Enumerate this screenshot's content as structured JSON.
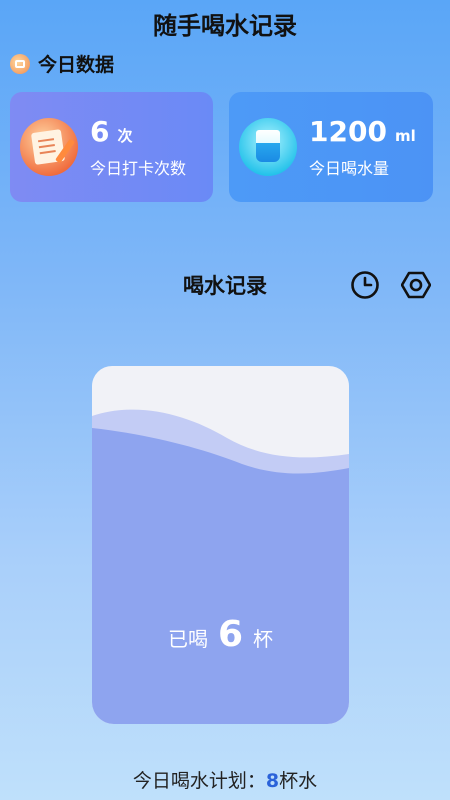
{
  "app": {
    "title": "随手喝水记录"
  },
  "today_section": {
    "title": "今日数据"
  },
  "stats": {
    "checkin": {
      "value": "6",
      "unit": "次",
      "label": "今日打卡次数",
      "icon": "notebook-icon"
    },
    "water": {
      "value": "1200",
      "unit": "ml",
      "label": "今日喝水量",
      "icon": "water-cup-icon"
    }
  },
  "record": {
    "title": "喝水记录",
    "icons": [
      "clock-icon",
      "settings-icon"
    ]
  },
  "glass": {
    "prefix": "已喝",
    "count": "6",
    "suffix": "杯",
    "fill_fraction": 0.75
  },
  "plan": {
    "label": "今日喝水计划：",
    "count": "8",
    "unit": "杯水"
  },
  "colors": {
    "accent": "#2a62d9",
    "water": "#8ea4ef",
    "card_left": "#7f8bf3",
    "card_right": "#4d9af7"
  }
}
